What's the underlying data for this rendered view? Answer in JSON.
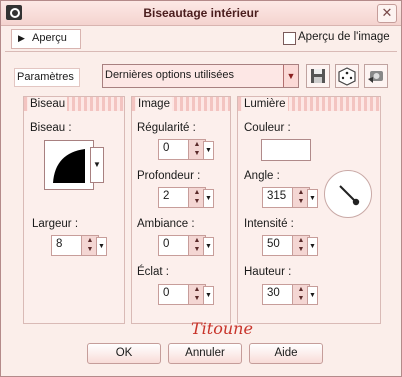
{
  "window": {
    "title": "Biseautage intérieur"
  },
  "topbar": {
    "apercu_label": "Aperçu",
    "apercu_image_label": "Aperçu de l'image"
  },
  "presets": {
    "label": "Paramètres",
    "value": "Dernières options utilisées"
  },
  "bevel": {
    "group_label": "Biseau",
    "bevel_label": "Biseau :",
    "width_label": "Largeur :",
    "width_value": "8"
  },
  "image": {
    "group_label": "Image",
    "smoothness_label": "Régularité :",
    "smoothness_value": "0",
    "depth_label": "Profondeur :",
    "depth_value": "2",
    "ambience_label": "Ambiance :",
    "ambience_value": "0",
    "shininess_label": "Éclat :",
    "shininess_value": "0"
  },
  "light": {
    "group_label": "Lumière",
    "color_label": "Couleur :",
    "angle_label": "Angle :",
    "angle_value": "315",
    "intensity_label": "Intensité :",
    "intensity_value": "50",
    "elevation_label": "Hauteur :",
    "elevation_value": "30"
  },
  "watermark": "Titoune",
  "buttons": {
    "ok": "OK",
    "cancel": "Annuler",
    "help": "Aide"
  },
  "colors": {
    "accent": "#c8332a",
    "panel": "#fbeeea",
    "stripe": "#f3c4c1"
  },
  "icons": {
    "app": "camera-icon",
    "save": "save-icon",
    "random": "dice-icon",
    "reset": "reset-icon"
  }
}
